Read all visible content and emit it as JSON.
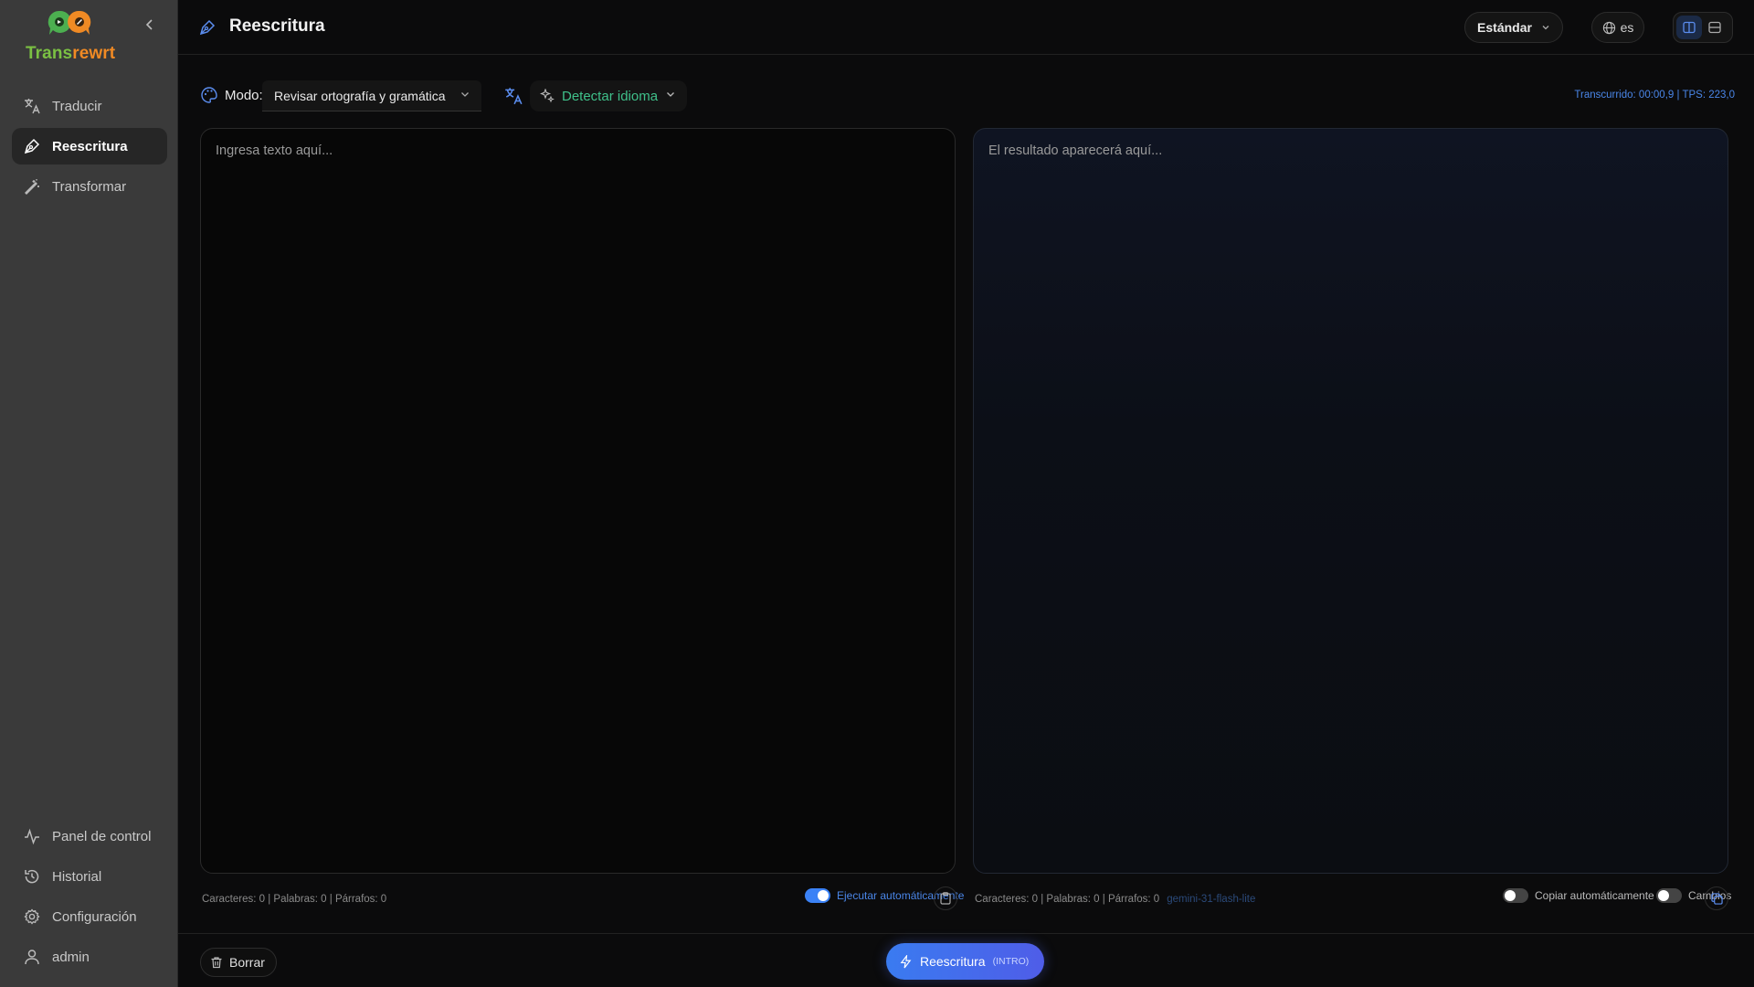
{
  "sidebar": {
    "brand": {
      "part1": "Trans",
      "part2": "rewrt"
    },
    "nav": [
      {
        "label": "Traducir",
        "icon": "translate-icon"
      },
      {
        "label": "Reescritura",
        "icon": "pen-icon",
        "active": true
      },
      {
        "label": "Transformar",
        "icon": "magic-wand-icon"
      }
    ],
    "bottom_nav": [
      {
        "label": "Panel de control",
        "icon": "activity-icon"
      },
      {
        "label": "Historial",
        "icon": "history-icon"
      },
      {
        "label": "Configuración",
        "icon": "gear-icon"
      },
      {
        "label": "admin",
        "icon": "user-icon"
      }
    ]
  },
  "header": {
    "title": "Reescritura",
    "style_select": "Estándar",
    "ui_language": "es"
  },
  "toolbar": {
    "mode_label": "Modo:",
    "mode_value": "Revisar ortografía y gramática",
    "language_detect": "Detectar idioma",
    "elapsed": "Transcurrido: 00:00,9 | TPS: 223,0"
  },
  "input": {
    "placeholder": "Ingresa texto aquí...",
    "stats": "Caracteres: 0 | Palabras: 0 | Párrafos: 0",
    "auto_run_label": "Ejecutar automáticamente",
    "auto_run_on": true
  },
  "output": {
    "placeholder": "El resultado aparecerá aquí...",
    "stats": "Caracteres: 0 | Palabras: 0 | Párrafos: 0",
    "model": "gemini-31-flash-lite",
    "auto_copy_label": "Copiar automáticamente",
    "auto_copy_on": false,
    "changes_label": "Cambios",
    "changes_on": false
  },
  "footer": {
    "clear_label": "Borrar",
    "run_label": "Reescritura",
    "run_shortcut": "(INTRO)"
  },
  "colors": {
    "accent": "#3b82f6",
    "brand_green": "#7bc043",
    "brand_orange": "#f08a24",
    "detect_green": "#3fc08a"
  }
}
